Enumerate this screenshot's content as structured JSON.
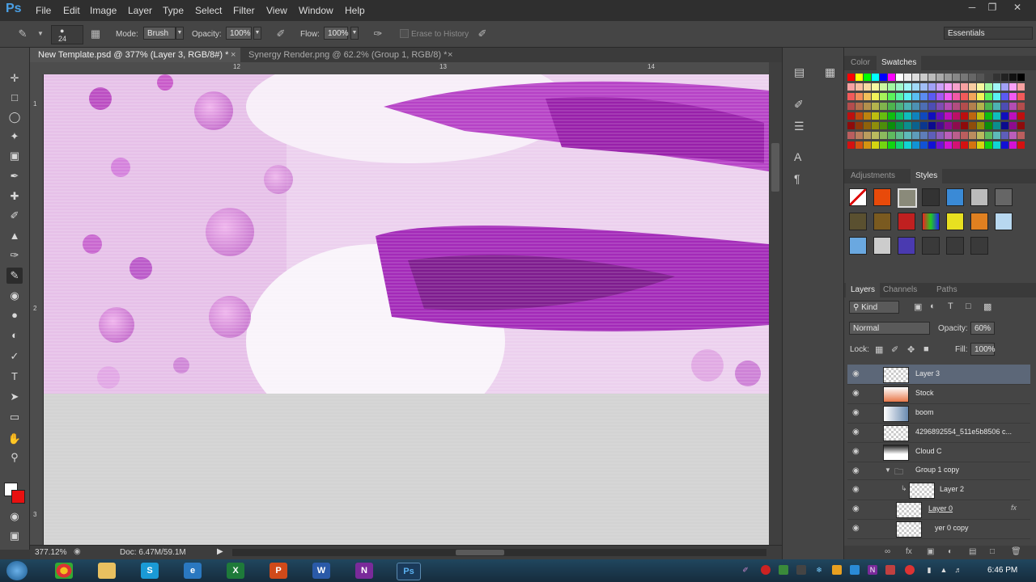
{
  "app": {
    "logo": "Ps"
  },
  "menu": [
    "File",
    "Edit",
    "Image",
    "Layer",
    "Type",
    "Select",
    "Filter",
    "View",
    "Window",
    "Help"
  ],
  "options": {
    "brush_size": "24",
    "mode_label": "Mode:",
    "mode_value": "Brush",
    "opacity_label": "Opacity:",
    "opacity_value": "100%",
    "flow_label": "Flow:",
    "flow_value": "100%",
    "erase_history": "Erase to History",
    "workspace": "Essentials"
  },
  "tabs": [
    {
      "label": "New Template.psd @ 377% (Layer 3, RGB/8#) *",
      "close": "×"
    },
    {
      "label": "Synergy Render.png @ 62.2% (Group 1, RGB/8) *",
      "close": "×"
    }
  ],
  "ruler": {
    "top": [
      "12",
      "13",
      "14"
    ],
    "left": [
      "1",
      "2",
      "3"
    ]
  },
  "status": {
    "zoom": "377.12%",
    "doc": "Doc: 6.47M/59.1M"
  },
  "panels": {
    "color_tab": "Color",
    "swatches_tab": "Swatches",
    "adjustments_tab": "Adjustments",
    "styles_tab": "Styles",
    "layers_tab": "Layers",
    "channels_tab": "Channels",
    "paths_tab": "Paths"
  },
  "layers_panel": {
    "kind": "Kind",
    "blend_mode": "Normal",
    "opacity_label": "Opacity:",
    "opacity_value": "60%",
    "lock_label": "Lock:",
    "fill_label": "Fill:",
    "fill_value": "100%",
    "layers": [
      {
        "name": "Layer 3"
      },
      {
        "name": "Stock"
      },
      {
        "name": "boom"
      },
      {
        "name": "4296892554_511e5b8506 c..."
      },
      {
        "name": "Cloud C"
      },
      {
        "name": "Group 1 copy"
      },
      {
        "name": "Layer 2"
      },
      {
        "name": "Layer 0",
        "fx": "fx"
      },
      {
        "name": "yer 0 copy"
      }
    ]
  },
  "taskbar": {
    "time": "6:46 PM"
  },
  "colors": {
    "accent": "#4aa0e6",
    "selected_layer": "#5c6778",
    "canvas_magenta": "#b030c0"
  }
}
